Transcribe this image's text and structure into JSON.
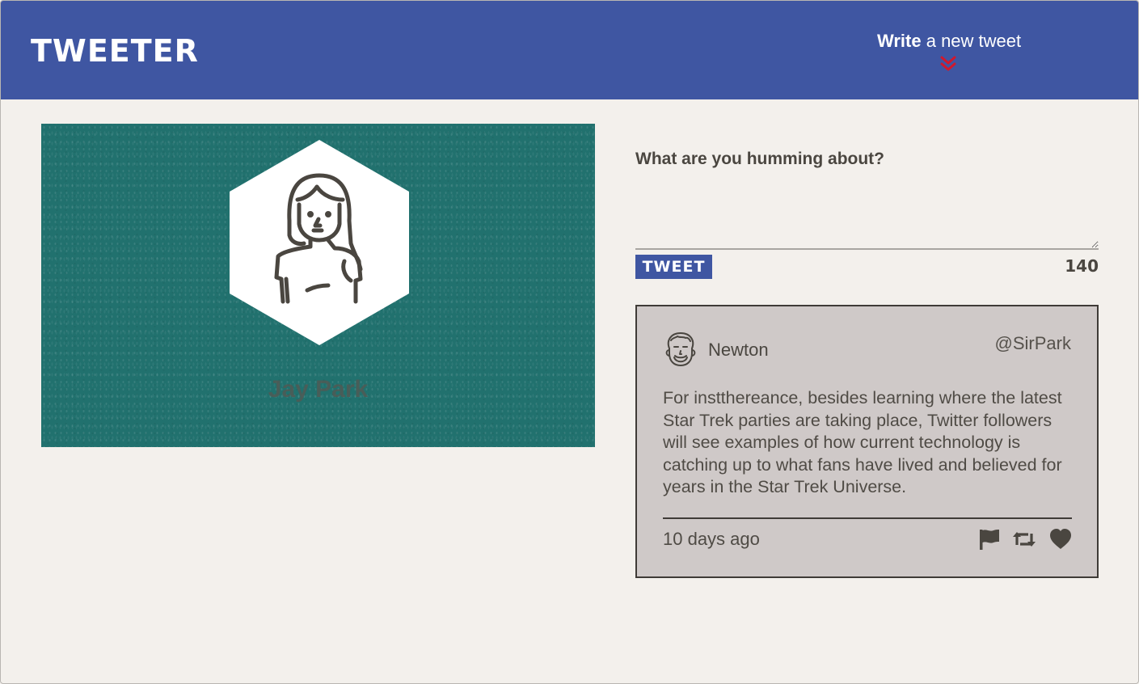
{
  "nav": {
    "brand": "Tweeter",
    "compose_strong": "Write",
    "compose_rest": " a new tweet",
    "chevron_icon": "double-chevron-down-icon",
    "accent_color": "#3f56a2",
    "chevron_color": "#d1182d"
  },
  "profile": {
    "name": "Jay Park",
    "avatar_icon": "woman-avatar-icon",
    "background_color": "#21716e"
  },
  "compose": {
    "label": "What are you humming about?",
    "textarea_value": "",
    "button_label": "Tweet",
    "counter": "140"
  },
  "tweets": [
    {
      "name": "Newton",
      "handle": "@SirPark",
      "avatar_icon": "man-avatar-icon",
      "body": "For instthereance, besides learning where the latest Star Trek parties are taking place, Twitter followers will see examples of how current technology is catching up to what fans have lived and believed for years in the Star Trek Universe.",
      "time": "10 days ago",
      "actions": [
        "flag-icon",
        "retweet-icon",
        "heart-icon"
      ]
    }
  ]
}
